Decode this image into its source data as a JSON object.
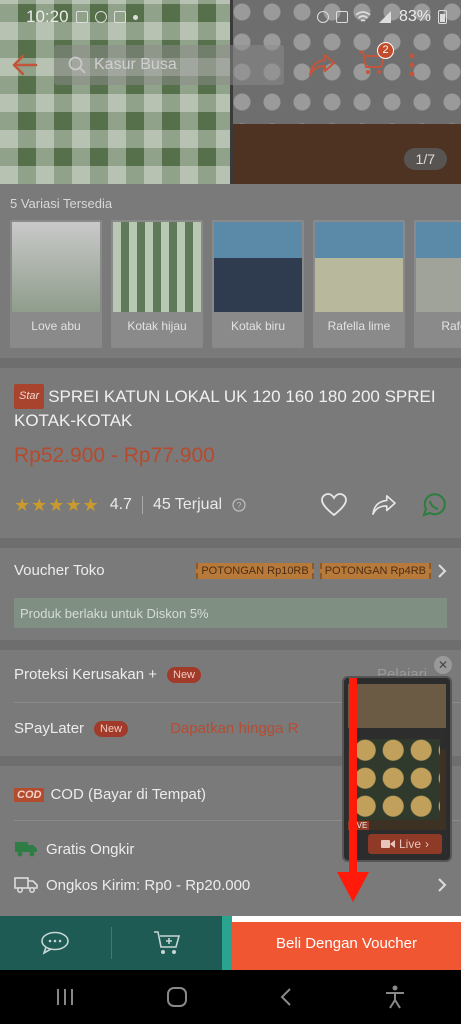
{
  "status_bar": {
    "time": "10:20",
    "battery": "83%"
  },
  "header": {
    "search_placeholder": "Kasur Busa",
    "cart_count": "2"
  },
  "gallery": {
    "counter": "1/7"
  },
  "variations": {
    "title": "5 Variasi Tersedia",
    "items": [
      {
        "label": "Love abu"
      },
      {
        "label": "Kotak hijau"
      },
      {
        "label": "Kotak biru"
      },
      {
        "label": "Rafella lime"
      },
      {
        "label": "Rafella"
      }
    ]
  },
  "product": {
    "badge": "Star",
    "title": "SPREI KATUN LOKAL UK 120 160 180 200 SPREI KOTAK-KOTAK",
    "price": "Rp52.900 - Rp77.900",
    "stars": "★★★★★",
    "rating": "4.7",
    "sold": "45 Terjual"
  },
  "voucher": {
    "label": "Voucher Toko",
    "tags": [
      "POTONGAN Rp10RB",
      "POTONGAN Rp4RB"
    ],
    "note": "Produk berlaku untuk Diskon 5%"
  },
  "protection": {
    "label": "Proteksi Kerusakan +",
    "badge": "New",
    "action": "Pelajari"
  },
  "spaylater": {
    "label": "SPayLater",
    "badge": "New",
    "promo": "Dapatkan hingga R"
  },
  "cod": {
    "badge": "COD",
    "label": "COD (Bayar di Tempat)"
  },
  "shipping": {
    "free": "Gratis Ongkir",
    "cost": "Ongkos Kirim: Rp0 - Rp20.000"
  },
  "live": {
    "label": "Live",
    "tag": "LIVE"
  },
  "bottom": {
    "buy_label": "Beli Dengan Voucher"
  },
  "colors": {
    "brand": "#ef5631",
    "chat_bar": "#1e5b54",
    "overlay_arrow": "#ff1a0a"
  }
}
